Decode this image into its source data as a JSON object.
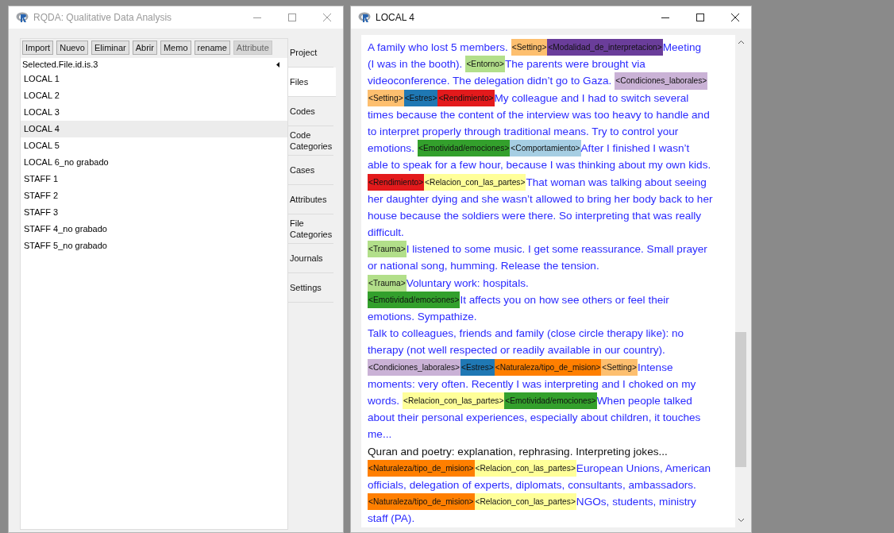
{
  "main_window": {
    "title": "RQDA: Qualitative Data Analysis",
    "active": false,
    "toolbar": [
      {
        "label": "Import",
        "disabled": false
      },
      {
        "label": "Nuevo",
        "disabled": false
      },
      {
        "label": "Eliminar",
        "disabled": false
      },
      {
        "label": "Abrir",
        "disabled": false
      },
      {
        "label": "Memo",
        "disabled": false
      },
      {
        "label": "rename",
        "disabled": false
      },
      {
        "label": "Attribute",
        "disabled": true
      }
    ],
    "list_header": "Selected.File.id.is.3",
    "files": [
      {
        "name": "LOCAL 1",
        "selected": false
      },
      {
        "name": "LOCAL 2",
        "selected": false
      },
      {
        "name": "LOCAL 3",
        "selected": false
      },
      {
        "name": "LOCAL 4",
        "selected": true
      },
      {
        "name": "LOCAL 5",
        "selected": false
      },
      {
        "name": "LOCAL 6_no grabado",
        "selected": false
      },
      {
        "name": "STAFF 1",
        "selected": false
      },
      {
        "name": "STAFF 2",
        "selected": false
      },
      {
        "name": "STAFF 3",
        "selected": false
      },
      {
        "name": "STAFF 4_no grabado",
        "selected": false
      },
      {
        "name": "STAFF 5_no grabado",
        "selected": false
      }
    ],
    "tabs": [
      {
        "label": "Project",
        "selected": false
      },
      {
        "label": "Files",
        "selected": true
      },
      {
        "label": "Codes",
        "selected": false
      },
      {
        "label": "Code Categories",
        "selected": false
      },
      {
        "label": "Cases",
        "selected": false
      },
      {
        "label": "Attributes",
        "selected": false
      },
      {
        "label": "File Categories",
        "selected": false
      },
      {
        "label": "Journals",
        "selected": false
      },
      {
        "label": "Settings",
        "selected": false
      }
    ]
  },
  "document_window": {
    "title": "LOCAL 4",
    "active": true,
    "lines": [
      [
        {
          "kind": "text",
          "text": "A family who lost 5 members.",
          "coded": true
        },
        {
          "kind": "code",
          "label": "<Setting>",
          "color": "#fdbf6f"
        },
        {
          "kind": "code",
          "label": "<Modalidad_de_interpretacion>",
          "color": "#6a3d9a"
        },
        {
          "kind": "text",
          "text": "Meeting",
          "coded": true
        }
      ],
      [
        {
          "kind": "text",
          "text": "(I was in the booth).",
          "coded": true
        },
        {
          "kind": "code",
          "label": "<Entorno>",
          "color": "#b2df8a"
        },
        {
          "kind": "text",
          "text": "The parents were brought via",
          "coded": true
        }
      ],
      [
        {
          "kind": "text",
          "text": "videoconference. The delegation didn’t go to Gaza.",
          "coded": true
        },
        {
          "kind": "code",
          "label": "<Condiciones_laborales>",
          "color": "#cab2d6"
        }
      ],
      [
        {
          "kind": "code",
          "label": "<Setting>",
          "color": "#fdbf6f"
        },
        {
          "kind": "code",
          "label": "<Estres>",
          "color": "#1f78b4"
        },
        {
          "kind": "code",
          "label": "<Rendimiento>",
          "color": "#e31a1c"
        },
        {
          "kind": "text",
          "text": "My colleague and I had to switch several",
          "coded": true
        }
      ],
      [
        {
          "kind": "text",
          "text": "times because the content of the interview was too heavy to handle and",
          "coded": true
        }
      ],
      [
        {
          "kind": "text",
          "text": "to interpret properly through traditional means. Try to control your",
          "coded": true
        }
      ],
      [
        {
          "kind": "text",
          "text": "emotions.",
          "coded": true
        },
        {
          "kind": "code",
          "label": "<Emotividad/emociones>",
          "color": "#33a02c"
        },
        {
          "kind": "code",
          "label": "<Comportamiento>",
          "color": "#a6cee3"
        },
        {
          "kind": "text",
          "text": "After I finished I wasn’t",
          "coded": true
        }
      ],
      [
        {
          "kind": "text",
          "text": "able to speak for a few hour, because I was thinking about my own kids.",
          "coded": true
        }
      ],
      [
        {
          "kind": "code",
          "label": "<Rendimiento>",
          "color": "#e31a1c"
        },
        {
          "kind": "code",
          "label": "<Relacion_con_las_partes>",
          "color": "#ffff99"
        },
        {
          "kind": "text",
          "text": "That woman was talking about seeing",
          "coded": true
        }
      ],
      [
        {
          "kind": "text",
          "text": "her daughter dying and she wasn’t allowed to bring her body back to her",
          "coded": true
        }
      ],
      [
        {
          "kind": "text",
          "text": "house because the soldiers were there. So interpreting that was really",
          "coded": true
        }
      ],
      [
        {
          "kind": "text",
          "text": "difficult.",
          "coded": true
        }
      ],
      [
        {
          "kind": "code",
          "label": "<Trauma>",
          "color": "#b2df8a"
        },
        {
          "kind": "text",
          "text": "I listened to some music. I get some reassurance. Small prayer",
          "coded": true
        }
      ],
      [
        {
          "kind": "text",
          "text": "or national song, humming. Release the tension.",
          "coded": true
        }
      ],
      [
        {
          "kind": "code",
          "label": "<Trauma>",
          "color": "#b2df8a"
        },
        {
          "kind": "text",
          "text": "Voluntary work: hospitals.",
          "coded": true
        }
      ],
      [
        {
          "kind": "code",
          "label": "<Emotividad/emociones>",
          "color": "#33a02c"
        },
        {
          "kind": "text",
          "text": "It affects you on how see others or feel their",
          "coded": true
        }
      ],
      [
        {
          "kind": "text",
          "text": "emotions. Sympathize.",
          "coded": true
        }
      ],
      [
        {
          "kind": "text",
          "text": "Talk to colleagues, friends and family (close circle therapy like): no",
          "coded": true
        }
      ],
      [
        {
          "kind": "text",
          "text": "therapy (not well respected or readily available in our country).",
          "coded": true
        }
      ],
      [
        {
          "kind": "code",
          "label": "<Condiciones_laborales>",
          "color": "#cab2d6"
        },
        {
          "kind": "code",
          "label": "<Estres>",
          "color": "#1f78b4"
        },
        {
          "kind": "code",
          "label": "<Naturaleza/tipo_de_mision>",
          "color": "#ff7f00"
        },
        {
          "kind": "code",
          "label": "<Setting>",
          "color": "#fdbf6f"
        },
        {
          "kind": "text",
          "text": "Intense",
          "coded": true
        }
      ],
      [
        {
          "kind": "text",
          "text": "moments: very often. Recently I was interpreting and I choked on my",
          "coded": true
        }
      ],
      [
        {
          "kind": "text",
          "text": "words.",
          "coded": true
        },
        {
          "kind": "code",
          "label": "<Relacion_con_las_partes>",
          "color": "#ffff99"
        },
        {
          "kind": "code",
          "label": "<Emotividad/emociones>",
          "color": "#33a02c"
        },
        {
          "kind": "text",
          "text": "When people talked",
          "coded": true
        }
      ],
      [
        {
          "kind": "text",
          "text": "about their personal experiences, especially about children, it touches",
          "coded": true
        }
      ],
      [
        {
          "kind": "text",
          "text": "me...",
          "coded": true
        }
      ],
      [
        {
          "kind": "text",
          "text": "Quran and poetry: explanation, rephrasing. Interpreting jokes...",
          "coded": false
        }
      ],
      [
        {
          "kind": "code",
          "label": "<Naturaleza/tipo_de_mision>",
          "color": "#ff7f00"
        },
        {
          "kind": "code",
          "label": "<Relacion_con_las_partes>",
          "color": "#ffff99"
        },
        {
          "kind": "text",
          "text": "European Unions, American",
          "coded": true
        }
      ],
      [
        {
          "kind": "text",
          "text": "officials, delegation of experts, diplomats, consultants, ambassadors.",
          "coded": true
        }
      ],
      [
        {
          "kind": "code",
          "label": "<Naturaleza/tipo_de_mision>",
          "color": "#ff7f00"
        },
        {
          "kind": "code",
          "label": "<Relacion_con_las_partes>",
          "color": "#ffff99"
        },
        {
          "kind": "text",
          "text": "NGOs, students, ministry",
          "coded": true
        }
      ],
      [
        {
          "kind": "text",
          "text": "staff (PA).",
          "coded": true
        }
      ]
    ]
  }
}
